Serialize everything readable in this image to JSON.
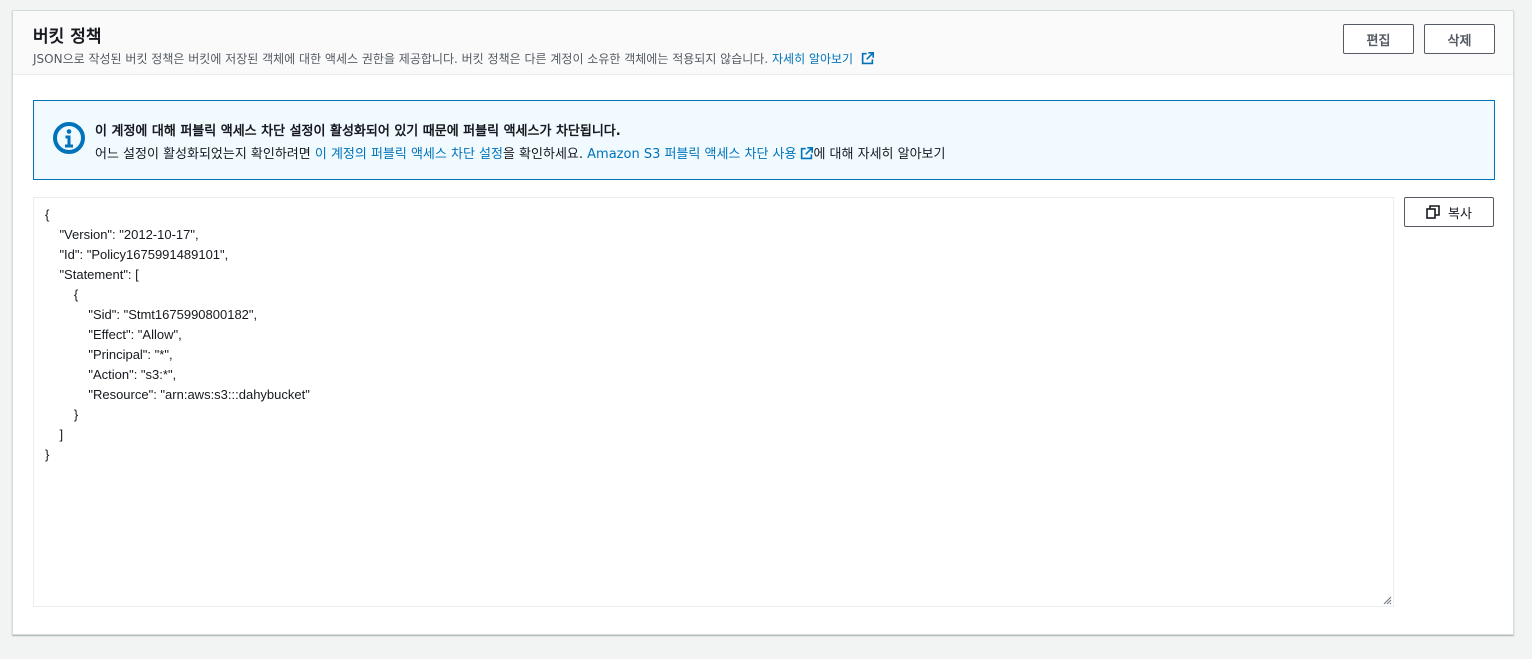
{
  "header": {
    "title": "버킷 정책",
    "description": "JSON으로 작성된 버킷 정책은 버킷에 저장된 객체에 대한 액세스 권한을 제공합니다. 버킷 정책은 다른 계정이 소유한 객체에는 적용되지 않습니다.",
    "learn_more": "자세히 알아보기",
    "edit_label": "편집",
    "delete_label": "삭제"
  },
  "alert": {
    "title": "이 계정에 대해 퍼블릭 액세스 차단 설정이 활성화되어 있기 때문에 퍼블릭 액세스가 차단됩니다.",
    "body_prefix": "어느 설정이 활성화되었는지 확인하려면 ",
    "account_settings_link": "이 계정의 퍼블릭 액세스 차단 설정",
    "body_middle": "을 확인하세요. ",
    "s3_link": "Amazon S3 퍼블릭 액세스 차단 사용",
    "body_suffix": "에 대해 자세히 알아보기"
  },
  "policy": {
    "json_text": "{\n    \"Version\": \"2012-10-17\",\n    \"Id\": \"Policy1675991489101\",\n    \"Statement\": [\n        {\n            \"Sid\": \"Stmt1675990800182\",\n            \"Effect\": \"Allow\",\n            \"Principal\": \"*\",\n            \"Action\": \"s3:*\",\n            \"Resource\": \"arn:aws:s3:::dahybucket\"\n        }\n    ]\n}"
  },
  "copy_label": "복사",
  "colors": {
    "link": "#0073bb",
    "alert_bg": "#f1faff",
    "alert_border": "#0073bb",
    "page_bg": "#f2f3f3"
  },
  "icons": {
    "info": "info-circle-icon",
    "external": "external-link-icon",
    "copy": "copy-icon"
  }
}
